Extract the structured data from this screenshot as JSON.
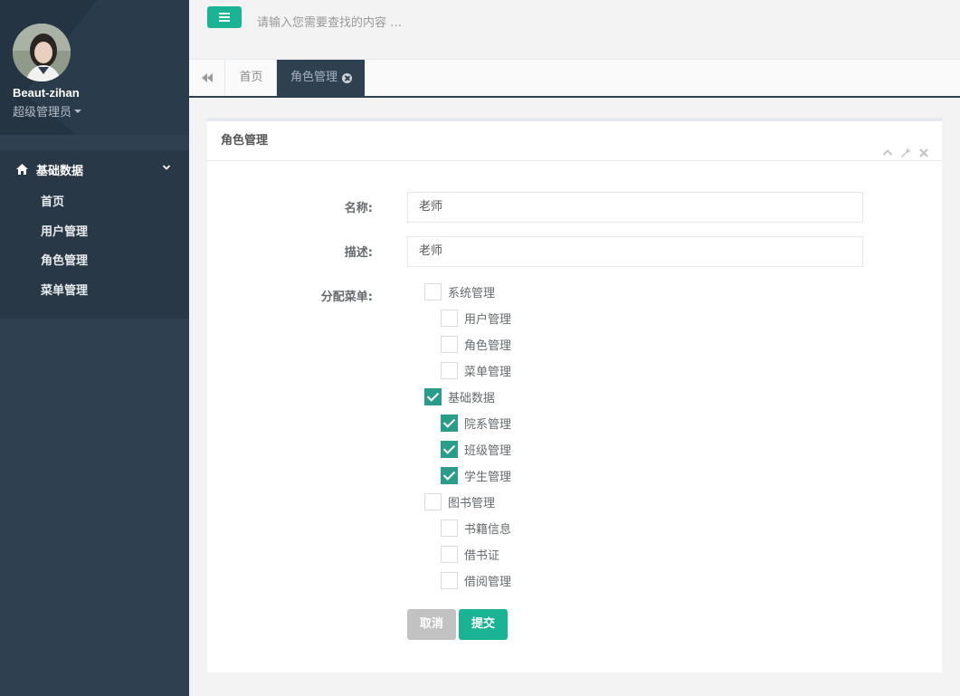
{
  "profile": {
    "name": "Beaut-zihan",
    "role": "超级管理员"
  },
  "sidebar": {
    "group_label": "基础数据",
    "items": [
      {
        "label": "首页"
      },
      {
        "label": "用户管理"
      },
      {
        "label": "角色管理"
      },
      {
        "label": "菜单管理"
      }
    ]
  },
  "topbar": {
    "search_placeholder": "请输入您需要查找的内容 …"
  },
  "tabs": {
    "home": "首页",
    "active": "角色管理"
  },
  "panel": {
    "title": "角色管理",
    "name_label": "名称:",
    "name_value": "老师",
    "desc_label": "描述:",
    "desc_value": "老师",
    "menu_label": "分配菜单:",
    "menus": [
      {
        "label": "系统管理",
        "checked": false,
        "level": 0
      },
      {
        "label": "用户管理",
        "checked": false,
        "level": 1
      },
      {
        "label": "角色管理",
        "checked": false,
        "level": 1
      },
      {
        "label": "菜单管理",
        "checked": false,
        "level": 1
      },
      {
        "label": "基础数据",
        "checked": true,
        "level": 0
      },
      {
        "label": "院系管理",
        "checked": true,
        "level": 1
      },
      {
        "label": "班级管理",
        "checked": true,
        "level": 1
      },
      {
        "label": "学生管理",
        "checked": true,
        "level": 1
      },
      {
        "label": "图书管理",
        "checked": false,
        "level": 0
      },
      {
        "label": "书籍信息",
        "checked": false,
        "level": 1
      },
      {
        "label": "借书证",
        "checked": false,
        "level": 1
      },
      {
        "label": "借阅管理",
        "checked": false,
        "level": 1
      }
    ],
    "cancel_label": "取消",
    "submit_label": "提交"
  },
  "colors": {
    "sidebar": "#2f4050",
    "accent": "#1ab394",
    "checked": "#2c9c8a"
  }
}
